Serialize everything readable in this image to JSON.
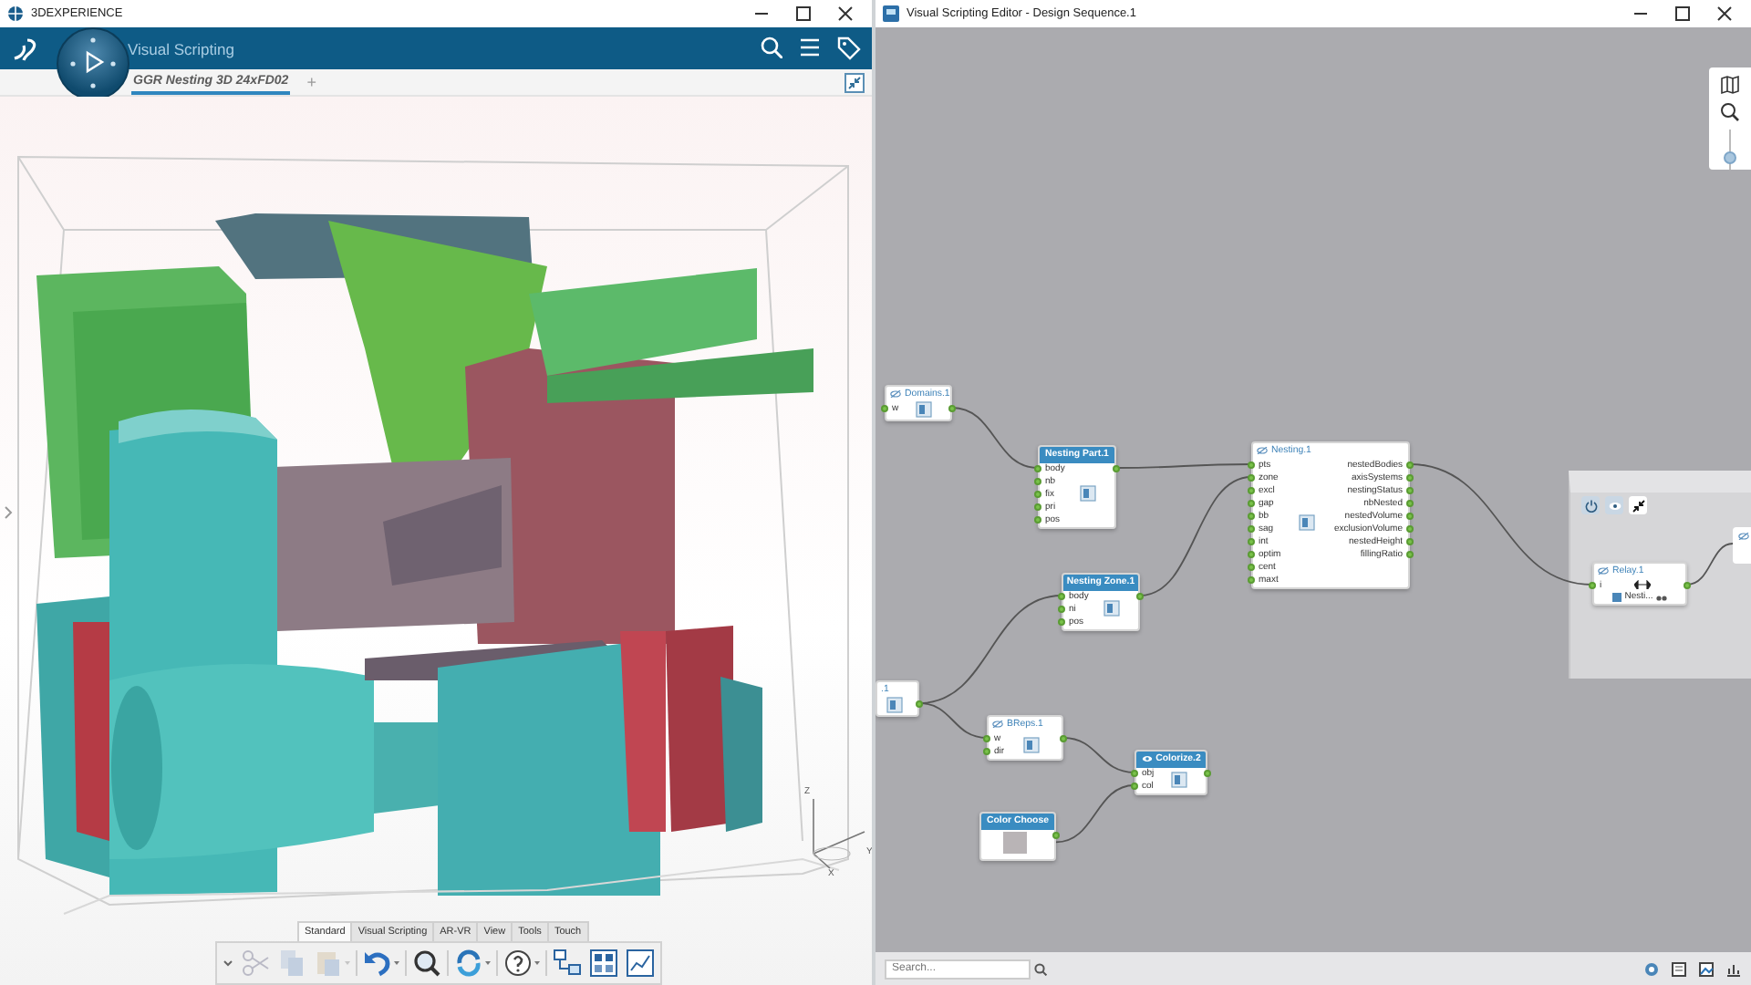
{
  "left_window": {
    "title": "3DEXPERIENCE",
    "app_name": "Visual Scripting",
    "tabs": [
      {
        "label": "GGR Nesting 3D 24xFD02",
        "selected": true
      }
    ],
    "add_tab": "+",
    "axis_labels": {
      "z": "Z",
      "y": "Y",
      "x": "X"
    },
    "toolbar_tabs": [
      {
        "label": "Standard",
        "selected": true
      },
      {
        "label": "Visual Scripting",
        "selected": false
      },
      {
        "label": "AR-VR",
        "selected": false
      },
      {
        "label": "View",
        "selected": false
      },
      {
        "label": "Tools",
        "selected": false
      },
      {
        "label": "Touch",
        "selected": false
      }
    ],
    "tools": [
      {
        "kind": "expand",
        "disabled": false,
        "dropdown": false
      },
      {
        "kind": "cut",
        "disabled": true,
        "dropdown": false
      },
      {
        "kind": "copy",
        "disabled": true,
        "dropdown": false
      },
      {
        "kind": "paste",
        "disabled": true,
        "dropdown": true
      },
      {
        "kind": "undo",
        "disabled": false,
        "dropdown": true
      },
      {
        "kind": "zoom",
        "disabled": false,
        "dropdown": false
      },
      {
        "kind": "rotate",
        "disabled": false,
        "dropdown": true
      },
      {
        "kind": "help",
        "disabled": false,
        "dropdown": true
      },
      {
        "kind": "graph",
        "disabled": false,
        "dropdown": false
      },
      {
        "kind": "grid",
        "disabled": false,
        "dropdown": false
      },
      {
        "kind": "chart",
        "disabled": false,
        "dropdown": false
      }
    ]
  },
  "right_window": {
    "title": "Visual Scripting Editor - Design Sequence.1",
    "zoom": {
      "level": 0.3
    },
    "nodes": [
      {
        "title": "Domains.1",
        "kind": "plain",
        "hidden": true,
        "inputs": [
          "w"
        ]
      },
      {
        "title": "Nesting Part.1",
        "kind": "blue",
        "inputs": [
          "body",
          "nb",
          "fix",
          "pri",
          "pos"
        ]
      },
      {
        "title": "Nesting Zone.1",
        "kind": "blue",
        "inputs": [
          "body",
          "ni",
          "pos"
        ]
      },
      {
        "title": "Nesting.1",
        "kind": "plain",
        "hidden": true,
        "inputs": [
          "pts",
          "zone",
          "excl",
          "gap",
          "bb",
          "sag",
          "int",
          "optim",
          "cent",
          "maxt"
        ],
        "outputs": [
          "nestedBodies",
          "axisSystems",
          "nestingStatus",
          "nbNested",
          "nestedVolume",
          "exclusionVolume",
          "nestedHeight",
          "fillingRatio"
        ]
      },
      {
        "title": ".1",
        "kind": "plain"
      },
      {
        "title": "BReps.1",
        "kind": "plain",
        "hidden": true,
        "inputs": [
          "w",
          "dir"
        ]
      },
      {
        "title": "Colorize.2",
        "kind": "blue",
        "hidden": false,
        "inputs": [
          "obj",
          "col"
        ]
      },
      {
        "title": "Color Choose",
        "kind": "blue"
      },
      {
        "title": "Relay.1",
        "kind": "plain",
        "hidden": true,
        "inputs": [
          "i"
        ],
        "value": "Nesti..."
      }
    ],
    "search": {
      "placeholder": "Search..."
    }
  }
}
